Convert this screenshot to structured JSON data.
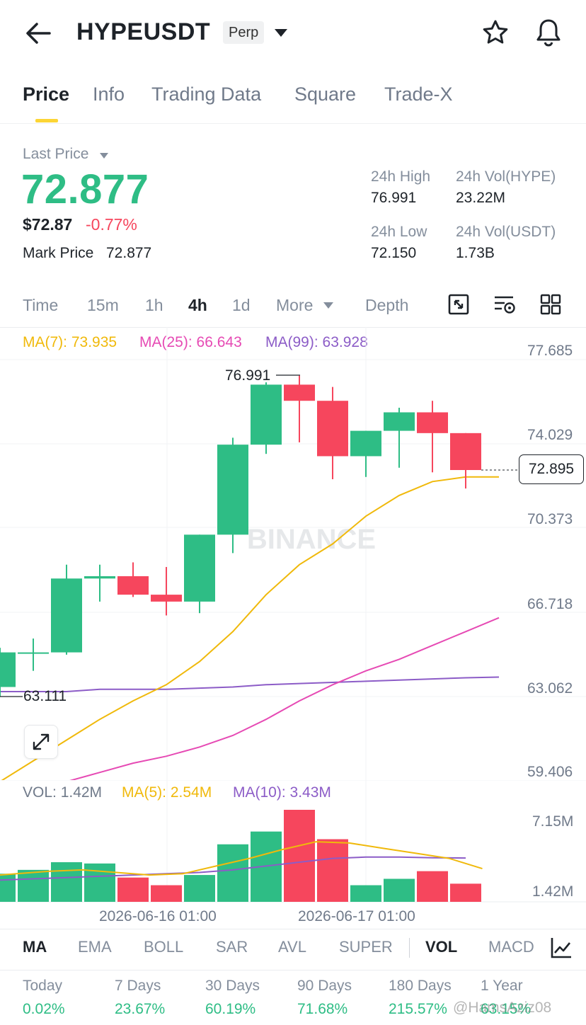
{
  "header": {
    "symbol": "HYPEUSDT",
    "badge": "Perp"
  },
  "tabs": [
    "Price",
    "Info",
    "Trading Data",
    "Square",
    "Trade-X"
  ],
  "price": {
    "last_label": "Last Price",
    "last": "72.877",
    "usd": "$72.87",
    "change": "-0.77%",
    "mark_label": "Mark Price",
    "mark": "72.877"
  },
  "stats": {
    "high_label": "24h High",
    "high": "76.991",
    "volb_label": "24h Vol(HYPE)",
    "volb": "23.22M",
    "low_label": "24h Low",
    "low": "72.150",
    "volq_label": "24h Vol(USDT)",
    "volq": "1.73B"
  },
  "timeframes": [
    "Time",
    "15m",
    "1h",
    "4h",
    "1d",
    "More",
    "Depth"
  ],
  "ma_legend": {
    "ma7": "MA(7): 73.935",
    "ma25": "MA(25): 66.643",
    "ma99": "MA(99): 63.928"
  },
  "vol_legend": {
    "vol": "VOL: 1.42M",
    "ma5": "MA(5): 2.54M",
    "ma10": "MA(10): 3.43M"
  },
  "watermark": "BINANCE",
  "indicators": [
    "MA",
    "EMA",
    "BOLL",
    "SAR",
    "AVL",
    "SUPER",
    "VOL",
    "MACD"
  ],
  "performance": [
    {
      "label": "Today",
      "value": "0.02%"
    },
    {
      "label": "7 Days",
      "value": "23.67%"
    },
    {
      "label": "30 Days",
      "value": "60.19%"
    },
    {
      "label": "90 Days",
      "value": "71.68%"
    },
    {
      "label": "180 Days",
      "value": "215.57%"
    },
    {
      "label": "1 Year",
      "value": "63.15%"
    }
  ],
  "credit": "@HamsAziz08",
  "colors": {
    "up": "#2ebd85",
    "down": "#f6465d",
    "ma7": "#f0b90b",
    "ma25": "#e64ab4",
    "ma99": "#8c5cc7",
    "accent": "#fcd535"
  },
  "chart_data": {
    "type": "candlestick",
    "timeframe": "4h",
    "y_ticks": [
      "77.685",
      "74.029",
      "70.373",
      "66.718",
      "63.062",
      "59.406"
    ],
    "ylim": [
      59.406,
      77.685
    ],
    "x_ticks": [
      "2026-06-16 01:00",
      "2026-06-17 01:00"
    ],
    "last_price_tag": "72.895",
    "high_marker": "76.991",
    "low_marker": "63.111",
    "candles": [
      {
        "o": 63.5,
        "h": 65.2,
        "l": 63.1,
        "c": 65.0
      },
      {
        "o": 65.0,
        "h": 65.6,
        "l": 64.2,
        "c": 65.0
      },
      {
        "o": 65.0,
        "h": 68.8,
        "l": 64.9,
        "c": 68.2
      },
      {
        "o": 68.2,
        "h": 68.8,
        "l": 67.2,
        "c": 68.3
      },
      {
        "o": 68.3,
        "h": 68.9,
        "l": 67.4,
        "c": 67.5
      },
      {
        "o": 67.5,
        "h": 68.7,
        "l": 66.6,
        "c": 67.2
      },
      {
        "o": 67.2,
        "h": 70.1,
        "l": 66.7,
        "c": 70.1
      },
      {
        "o": 70.1,
        "h": 74.3,
        "l": 69.3,
        "c": 74.0
      },
      {
        "o": 74.0,
        "h": 76.7,
        "l": 73.6,
        "c": 76.6
      },
      {
        "o": 76.6,
        "h": 76.99,
        "l": 74.1,
        "c": 75.9
      },
      {
        "o": 75.9,
        "h": 76.5,
        "l": 72.5,
        "c": 73.5
      },
      {
        "o": 73.5,
        "h": 74.2,
        "l": 72.6,
        "c": 74.6
      },
      {
        "o": 74.6,
        "h": 75.6,
        "l": 73.0,
        "c": 75.4
      },
      {
        "o": 75.4,
        "h": 75.9,
        "l": 72.8,
        "c": 74.5
      },
      {
        "o": 74.5,
        "h": 73.9,
        "l": 72.1,
        "c": 72.9
      }
    ],
    "ma7": [
      58.8,
      59.4,
      60.3,
      61.2,
      62.1,
      62.9,
      63.6,
      64.6,
      65.9,
      67.5,
      68.8,
      69.7,
      70.9,
      71.8,
      72.4,
      72.6,
      72.6
    ],
    "ma25": [
      58.3,
      58.6,
      59.0,
      59.4,
      59.8,
      60.2,
      60.5,
      60.9,
      61.4,
      62.1,
      62.9,
      63.6,
      64.2,
      64.7,
      65.3,
      65.9,
      66.5
    ],
    "ma99": [
      63.3,
      63.3,
      63.3,
      63.3,
      63.4,
      63.4,
      63.4,
      63.45,
      63.5,
      63.6,
      63.65,
      63.7,
      63.75,
      63.8,
      63.85,
      63.9,
      63.93
    ],
    "volume_ticks": [
      "7.15M",
      "1.42M"
    ],
    "volumes": [
      2.2,
      2.5,
      3.1,
      3.0,
      1.9,
      1.3,
      2.1,
      4.5,
      5.5,
      7.2,
      4.9,
      1.3,
      1.8,
      2.4,
      1.42
    ],
    "vol_ma5": [
      2.0,
      2.2,
      2.4,
      2.5,
      2.3,
      2.1,
      2.2,
      2.8,
      3.4,
      4.1,
      4.7,
      4.6,
      4.2,
      3.8,
      3.4,
      2.6
    ],
    "vol_ma10": [
      1.7,
      1.8,
      1.9,
      2.0,
      2.1,
      2.2,
      2.3,
      2.5,
      2.8,
      3.1,
      3.4,
      3.5,
      3.5,
      3.45,
      3.43
    ]
  }
}
